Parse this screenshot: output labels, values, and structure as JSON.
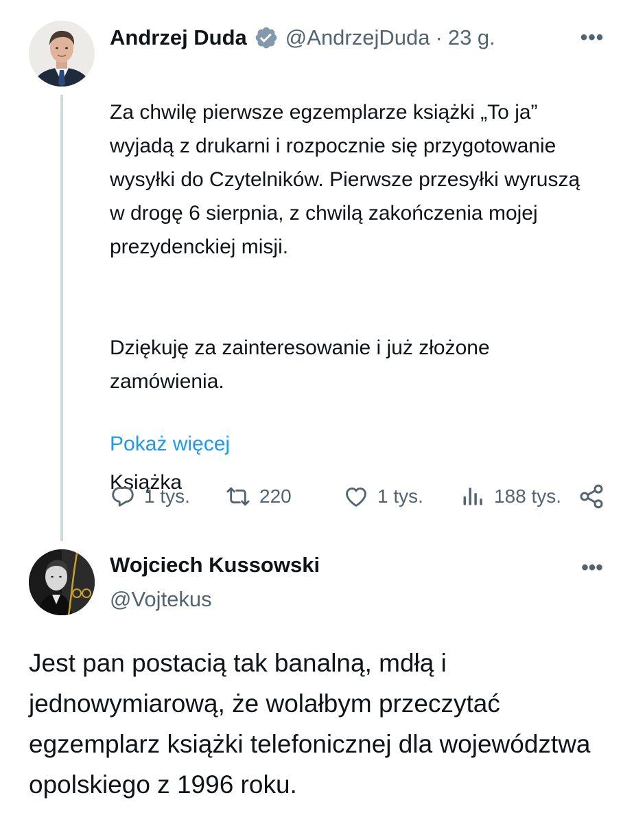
{
  "tweet": {
    "author_name": "Andrzej Duda",
    "author_handle": "@AndrzejDuda",
    "separator": "·",
    "time": "23 g.",
    "more": "•••",
    "paragraphs": [
      "Za chwilę pierwsze egzemplarze książki „To ja” wyjadą z drukarni i rozpocznie się przygotowanie wysyłki do Czytelników. Pierwsze przesyłki wyruszą w drogę 6 sierpnia, z chwilą zakończenia mojej prezydenckiej misji.",
      "Dziękuję za zainteresowanie i już złożone zamówienia.",
      "Książka"
    ],
    "show_more": "Pokaż więcej",
    "replies": "1 tys.",
    "reposts": "220",
    "likes": "1 tys.",
    "views": "188 tys.",
    "icons": {
      "verified": "verified-badge-icon",
      "reply": "reply-icon",
      "repost": "repost-icon",
      "like": "heart-icon",
      "views": "views-icon",
      "share": "share-icon"
    },
    "colors": {
      "text": "#0f1419",
      "muted": "#536471",
      "link": "#1d9bf0",
      "thread_line": "#cfd9de",
      "verified": "#829aab"
    }
  },
  "reply": {
    "author_name": "Wojciech Kussowski",
    "author_handle": "@Vojtekus",
    "more": "•••",
    "text": "Jest pan postacią tak banalną, mdłą i jednowymiarową, że wolałbym przeczytać egzemplarz książki telefonicznej dla województwa opolskiego z  1996 roku."
  }
}
